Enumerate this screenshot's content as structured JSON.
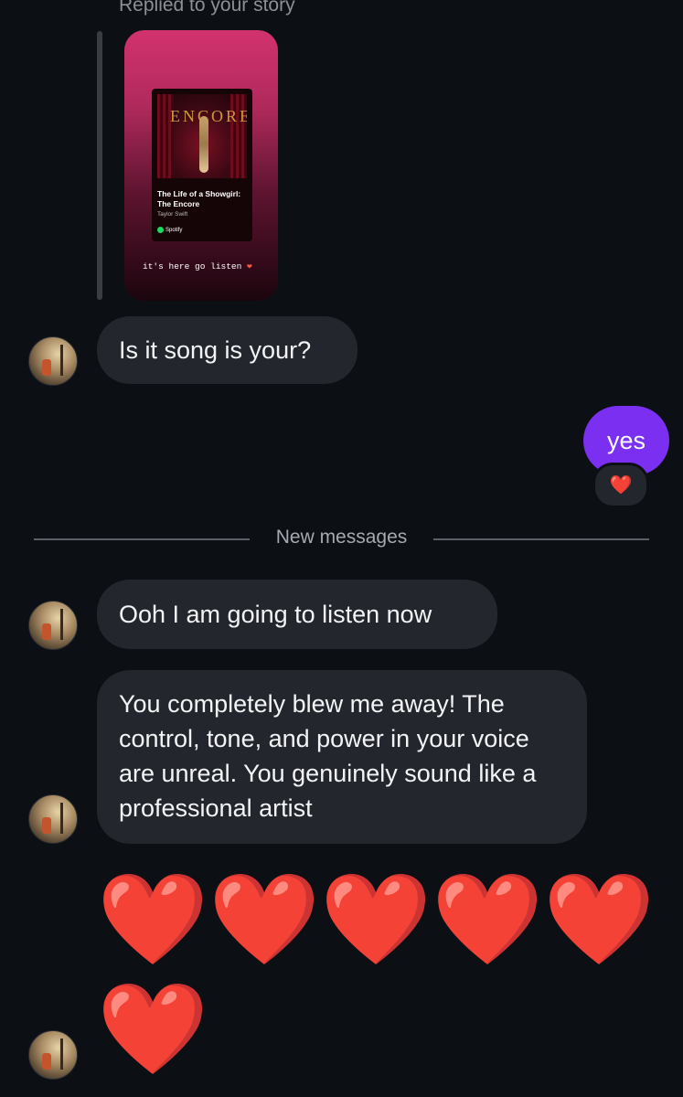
{
  "reply_context": {
    "label": "Replied to your story",
    "story": {
      "album_title": "The Life of a Showgirl: The Encore",
      "album_word": "ENCORE",
      "artist": "Taylor Swift",
      "platform": "Spotify",
      "caption": "it's here go listen"
    }
  },
  "messages": [
    {
      "sender": "other",
      "text": "Is it song is your?"
    },
    {
      "sender": "me",
      "text": "yes",
      "reaction": "❤️"
    }
  ],
  "divider": {
    "label": "New messages"
  },
  "new_messages": [
    {
      "sender": "other",
      "text": "Ooh I am going to listen now"
    },
    {
      "sender": "other",
      "text": "You completely blew me away! The control, tone, and power in your voice are unreal. You genuinely sound like a professional artist"
    },
    {
      "sender": "other",
      "text": "❤️❤️❤️❤️❤️❤️"
    }
  ],
  "colors": {
    "background": "#0c0f14",
    "incoming_bubble": "#23262d",
    "outgoing_bubble": "#7b2ff1",
    "heart": "#e2232e"
  },
  "icons": {
    "avatar": "contact-avatar",
    "heart": "red-heart-emoji"
  }
}
